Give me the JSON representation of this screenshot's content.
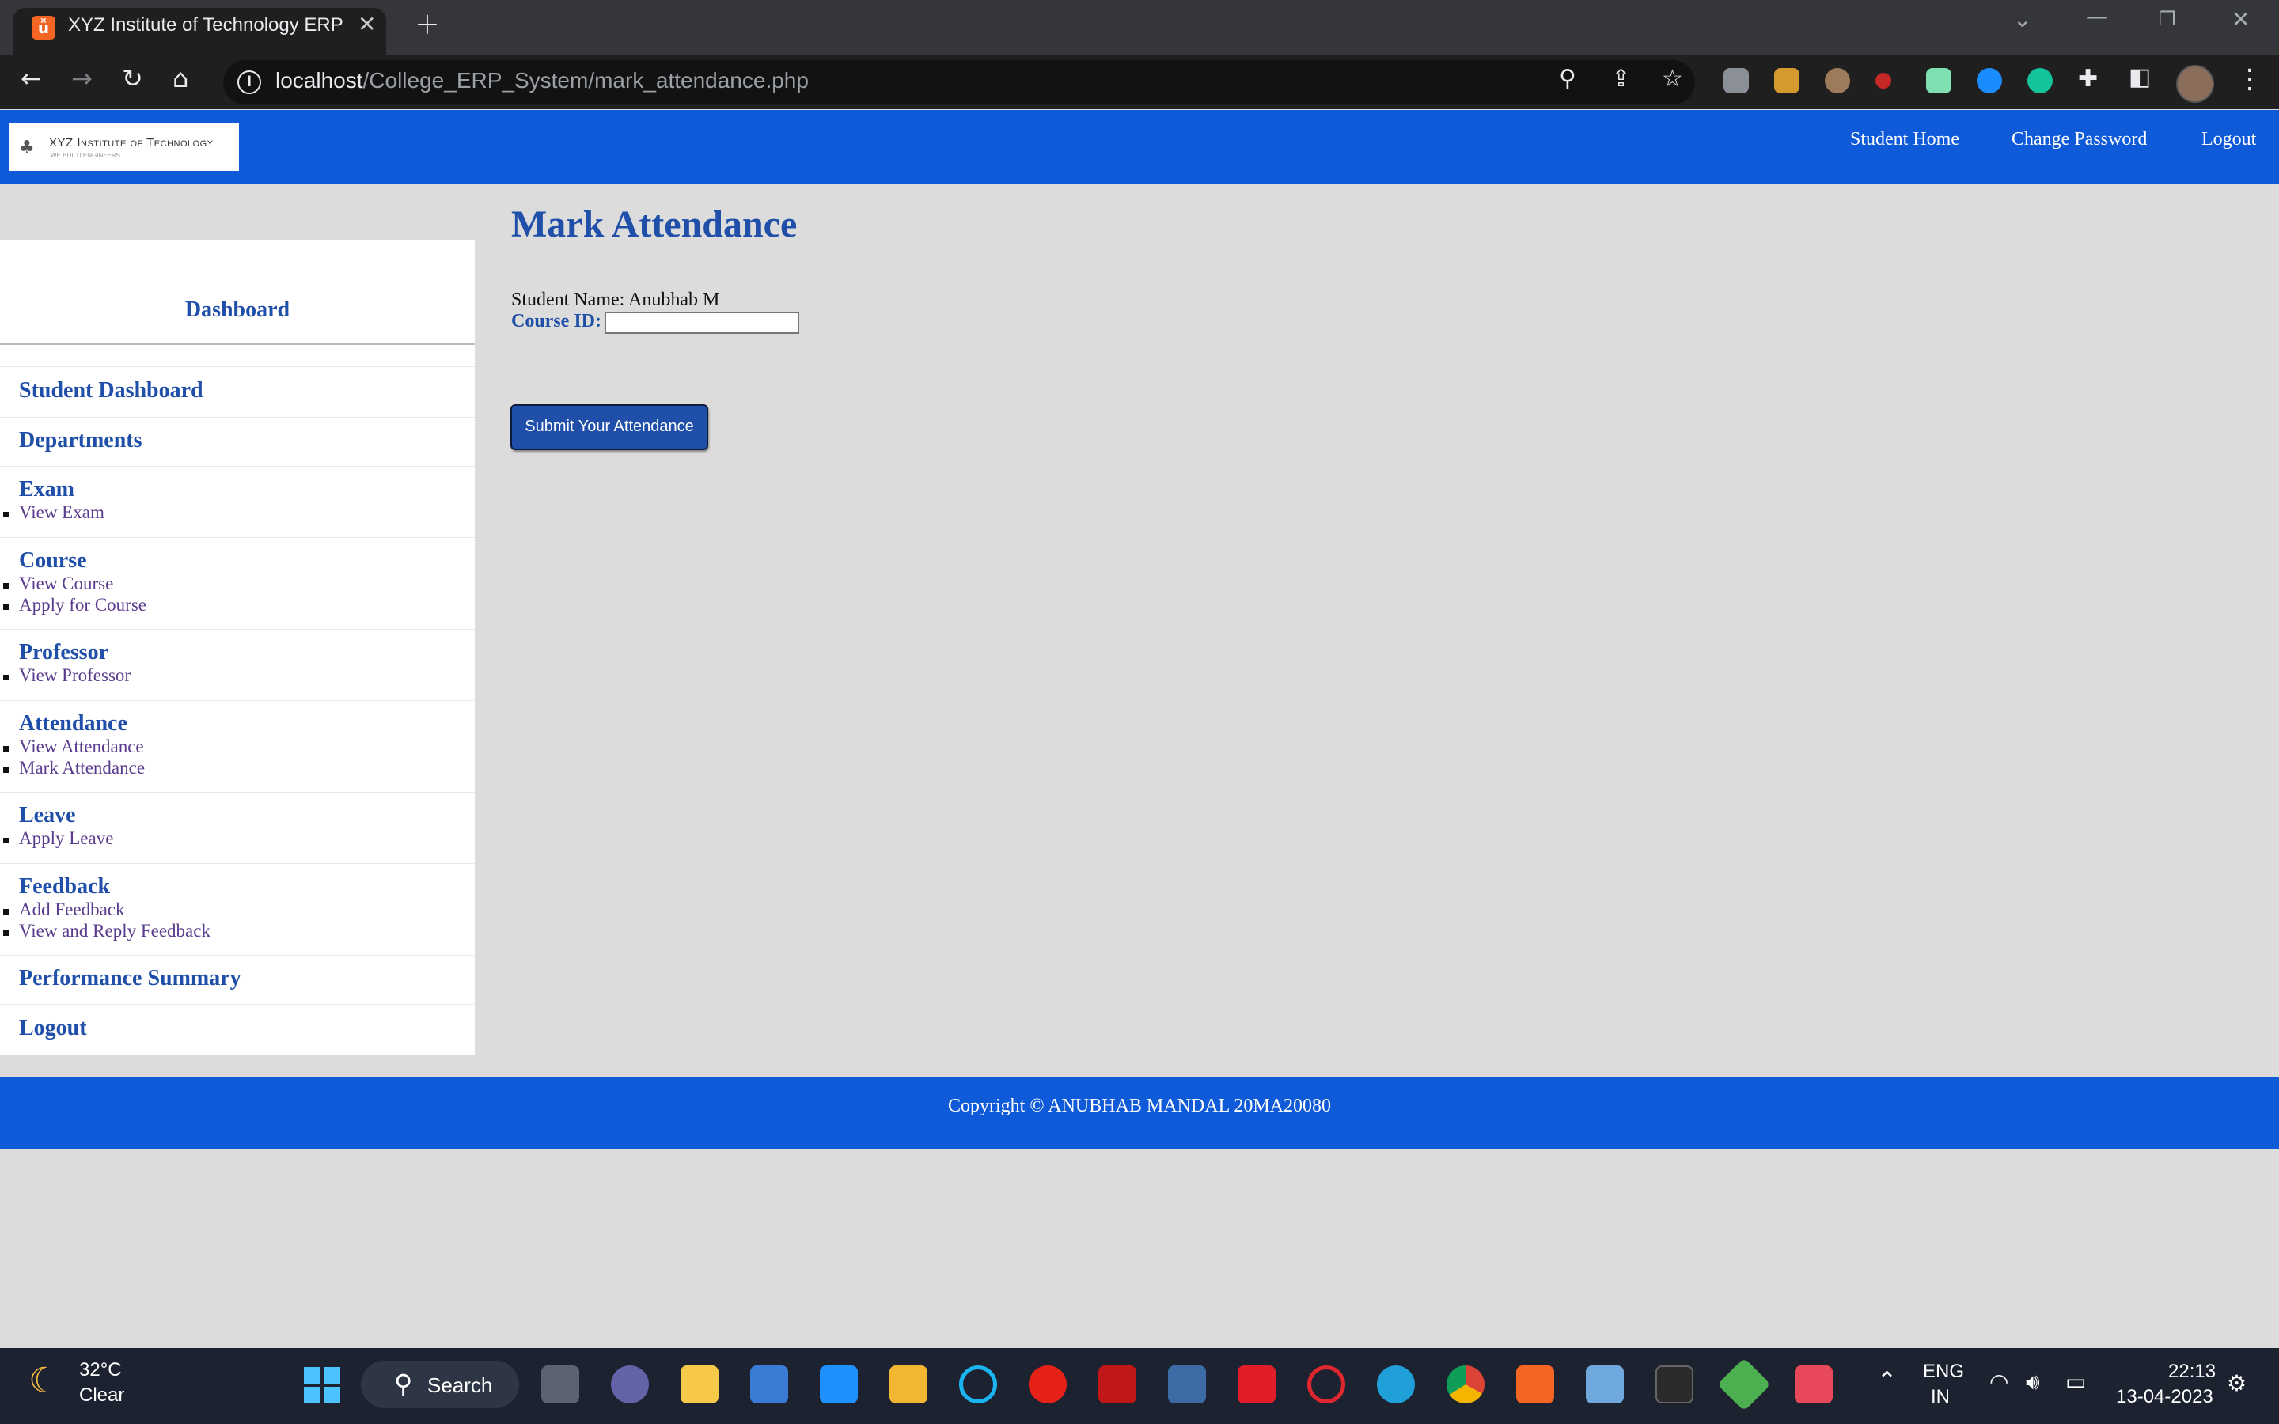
{
  "browser": {
    "tab_title": "XYZ Institute of Technology ERP",
    "url_host": "localhost",
    "url_path": "/College_ERP_System/mark_attendance.php"
  },
  "header": {
    "logo_text": "XYZ Institute of Technology",
    "logo_sub": "WE BUILD ENGINEERS",
    "nav": [
      "Student Home",
      "Change Password",
      "Logout"
    ]
  },
  "sidebar": {
    "title": "Dashboard",
    "sections": [
      {
        "label": "Student Dashboard",
        "items": []
      },
      {
        "label": "Departments",
        "items": []
      },
      {
        "label": "Exam",
        "items": [
          "View Exam"
        ]
      },
      {
        "label": "Course",
        "items": [
          "View Course",
          "Apply for Course"
        ]
      },
      {
        "label": "Professor",
        "items": [
          "View Professor"
        ]
      },
      {
        "label": "Attendance",
        "items": [
          "View Attendance",
          "Mark Attendance"
        ]
      },
      {
        "label": "Leave",
        "items": [
          "Apply Leave"
        ]
      },
      {
        "label": "Feedback",
        "items": [
          "Add Feedback",
          "View and Reply Feedback"
        ]
      },
      {
        "label": "Performance Summary",
        "items": []
      },
      {
        "label": "Logout",
        "items": []
      }
    ]
  },
  "main": {
    "title": "Mark Attendance",
    "student_name": "Student Name: Anubhab M",
    "course_label": "Course ID:",
    "course_value": "",
    "submit_label": "Submit Your Attendance"
  },
  "footer": {
    "text": "Copyright © ANUBHAB MANDAL 20MA20080"
  },
  "taskbar": {
    "weather_temp": "32°C",
    "weather_desc": "Clear",
    "search_label": "Search",
    "lang_top": "ENG",
    "lang_bottom": "IN",
    "time": "22:13",
    "date": "13-04-2023"
  },
  "colors": {
    "nav_blue": "#0f5ad8",
    "heading_blue": "#1f4fa8",
    "link_purple": "#5a3b8e",
    "page_bg": "#dcdcdc"
  }
}
